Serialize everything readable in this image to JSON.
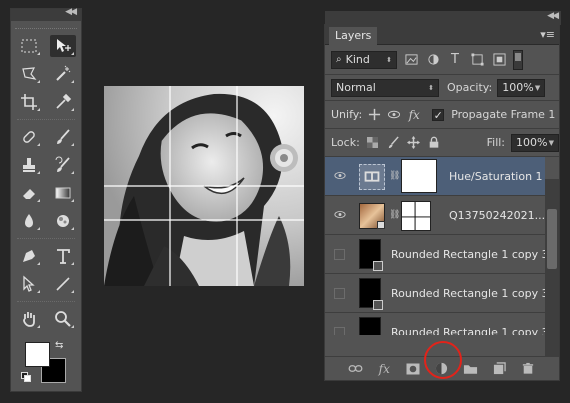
{
  "tools_panel": {
    "collapse_label": "◀◀",
    "tools": [
      [
        "rect-marquee",
        "move"
      ],
      [
        "lasso",
        "magic-wand"
      ],
      [
        "crop",
        "eyedropper"
      ],
      [
        "healing-brush",
        "brush"
      ],
      [
        "clone-stamp",
        "history-brush"
      ],
      [
        "eraser",
        "gradient"
      ],
      [
        "blur",
        "dodge"
      ],
      [
        "pen",
        "type"
      ],
      [
        "path-selection",
        "line"
      ],
      [
        "hand",
        "zoom"
      ]
    ]
  },
  "layers_panel": {
    "collapse_label": "◀◀",
    "tab_label": "Layers",
    "panel_menu_label": "▾≡",
    "filter": {
      "value": "Kind"
    },
    "blend_mode": {
      "value": "Normal"
    },
    "opacity": {
      "label": "Opacity:",
      "value": "100%"
    },
    "unify": {
      "label": "Unify:",
      "propagate_label": "Propagate Frame 1",
      "propagate_checked": true
    },
    "lock": {
      "label": "Lock:"
    },
    "fill": {
      "label": "Fill:",
      "value": "100%"
    },
    "layers": [
      {
        "name": "Hue/Saturation 1",
        "visible": true,
        "selected": true
      },
      {
        "name": "Q13750242021...",
        "visible": true,
        "selected": false
      },
      {
        "name": "Rounded Rectangle 1 copy 3",
        "visible": false,
        "selected": false
      },
      {
        "name": "Rounded Rectangle 1 copy 3",
        "visible": false,
        "selected": false
      },
      {
        "name": "Rounded Rectangle 1 copy 3",
        "visible": false,
        "selected": false
      }
    ],
    "footer_icons": [
      "link-icon",
      "fx-icon",
      "mask-icon",
      "adjustment-icon",
      "group-icon",
      "new-layer-icon",
      "trash-icon"
    ]
  },
  "colors": {
    "panel_bg": "#535353",
    "selected_layer": "#4d5f78",
    "highlight_ring": "#e2231a"
  }
}
